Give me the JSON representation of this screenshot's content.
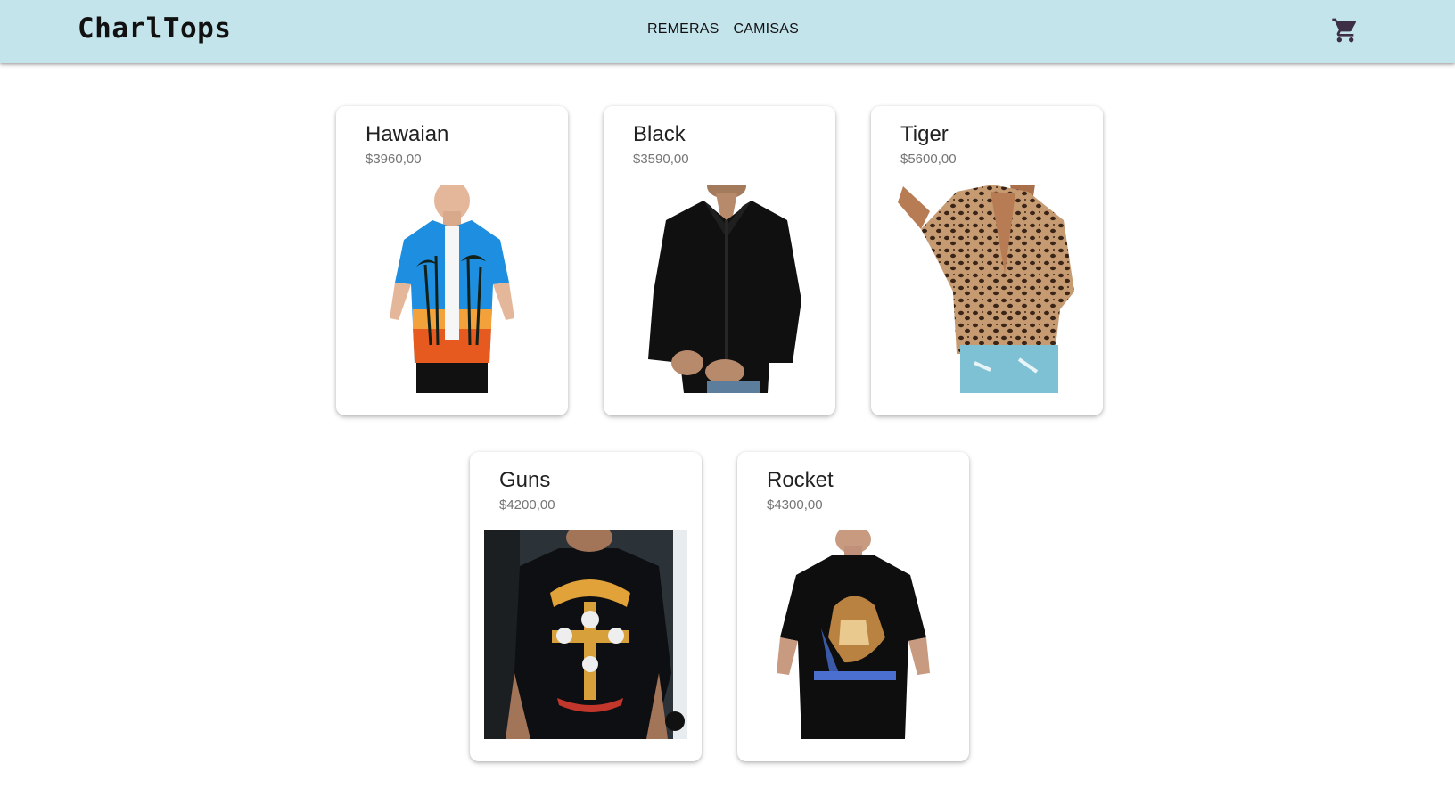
{
  "header": {
    "brand": "CharlTops",
    "nav": [
      {
        "label": "REMERAS"
      },
      {
        "label": "CAMISAS"
      }
    ],
    "cart_icon": "shopping-cart-icon",
    "background": "#c4e4ec"
  },
  "products": [
    {
      "title": "Hawaian",
      "price": "$3960,00",
      "image": "hawaiian-shirt-photo"
    },
    {
      "title": "Black",
      "price": "$3590,00",
      "image": "black-shirt-photo"
    },
    {
      "title": "Tiger",
      "price": "$5600,00",
      "image": "leopard-shirt-photo"
    },
    {
      "title": "Guns",
      "price": "$4200,00",
      "image": "guns-tshirt-photo"
    },
    {
      "title": "Rocket",
      "price": "$4300,00",
      "image": "rocket-tshirt-photo"
    }
  ]
}
